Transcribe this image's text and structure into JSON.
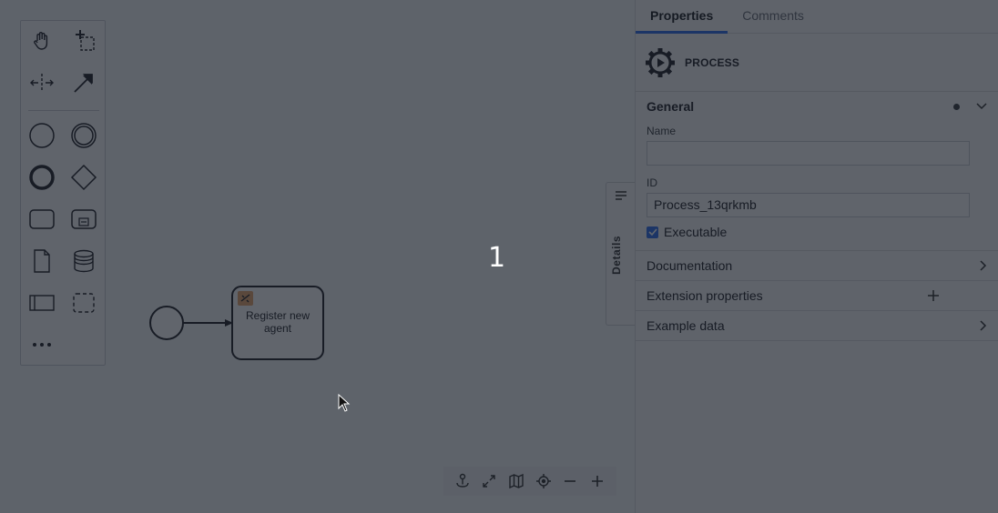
{
  "step_number": "1",
  "palette": {
    "tools": [
      {
        "name": "hand-tool-icon"
      },
      {
        "name": "lasso-tool-icon"
      },
      {
        "name": "space-tool-icon"
      },
      {
        "name": "connect-tool-icon"
      },
      {
        "name": "start-event-icon"
      },
      {
        "name": "intermediate-event-icon"
      },
      {
        "name": "end-event-icon"
      },
      {
        "name": "gateway-icon"
      },
      {
        "name": "task-icon"
      },
      {
        "name": "subprocess-icon"
      },
      {
        "name": "data-object-icon"
      },
      {
        "name": "data-store-icon"
      },
      {
        "name": "pool-icon"
      },
      {
        "name": "group-icon"
      },
      {
        "name": "more-icon"
      }
    ]
  },
  "diagram": {
    "task_label": "Register new agent"
  },
  "details_tab": {
    "label": "Details"
  },
  "panel": {
    "tabs": [
      "Properties",
      "Comments"
    ],
    "header_title": "PROCESS",
    "general": {
      "title": "General",
      "name_label": "Name",
      "name_value": "",
      "id_label": "ID",
      "id_value": "Process_13qrkmb",
      "executable_label": "Executable",
      "executable_checked": true
    },
    "groups": [
      "Documentation",
      "Extension properties",
      "Example data"
    ]
  },
  "colors": {
    "accent": "#2f6fed",
    "dim_overlay": "#141a24"
  }
}
